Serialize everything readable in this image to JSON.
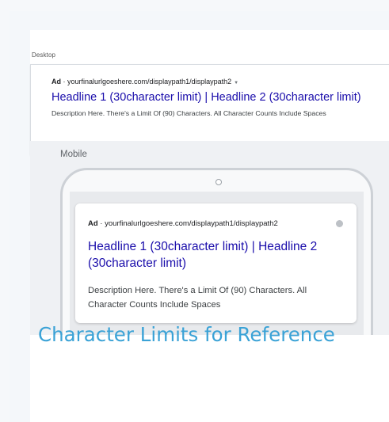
{
  "desktop": {
    "label": "Desktop",
    "ad_badge": "Ad",
    "separator": " · ",
    "url": "yourfinalurlgoeshere.com/displaypath1/displaypath2",
    "dropdown_arrow": "▼",
    "headline": "Headline 1 (30character limit) | Headline 2 (30character limit)",
    "description": "Description Here. There's a Limit Of (90) Characters. All Character Counts Include Spaces"
  },
  "mobile": {
    "label": "Mobile",
    "ad_badge": "Ad",
    "separator": " · ",
    "url": "yourfinalurlgoeshere.com/displaypath1/displaypath2",
    "headline": "Headline 1 (30character limit) | Headline 2 (30character limit)",
    "description": "Description Here. There's a Limit Of (90) Characters. All Character Counts Include Spaces",
    "info_icon": "info-icon"
  },
  "footer": {
    "title": "Character Limits for Reference"
  },
  "colors": {
    "headline_link": "#1a0dab",
    "title_accent": "#3aa2d6",
    "background": "#f4f7fa"
  }
}
